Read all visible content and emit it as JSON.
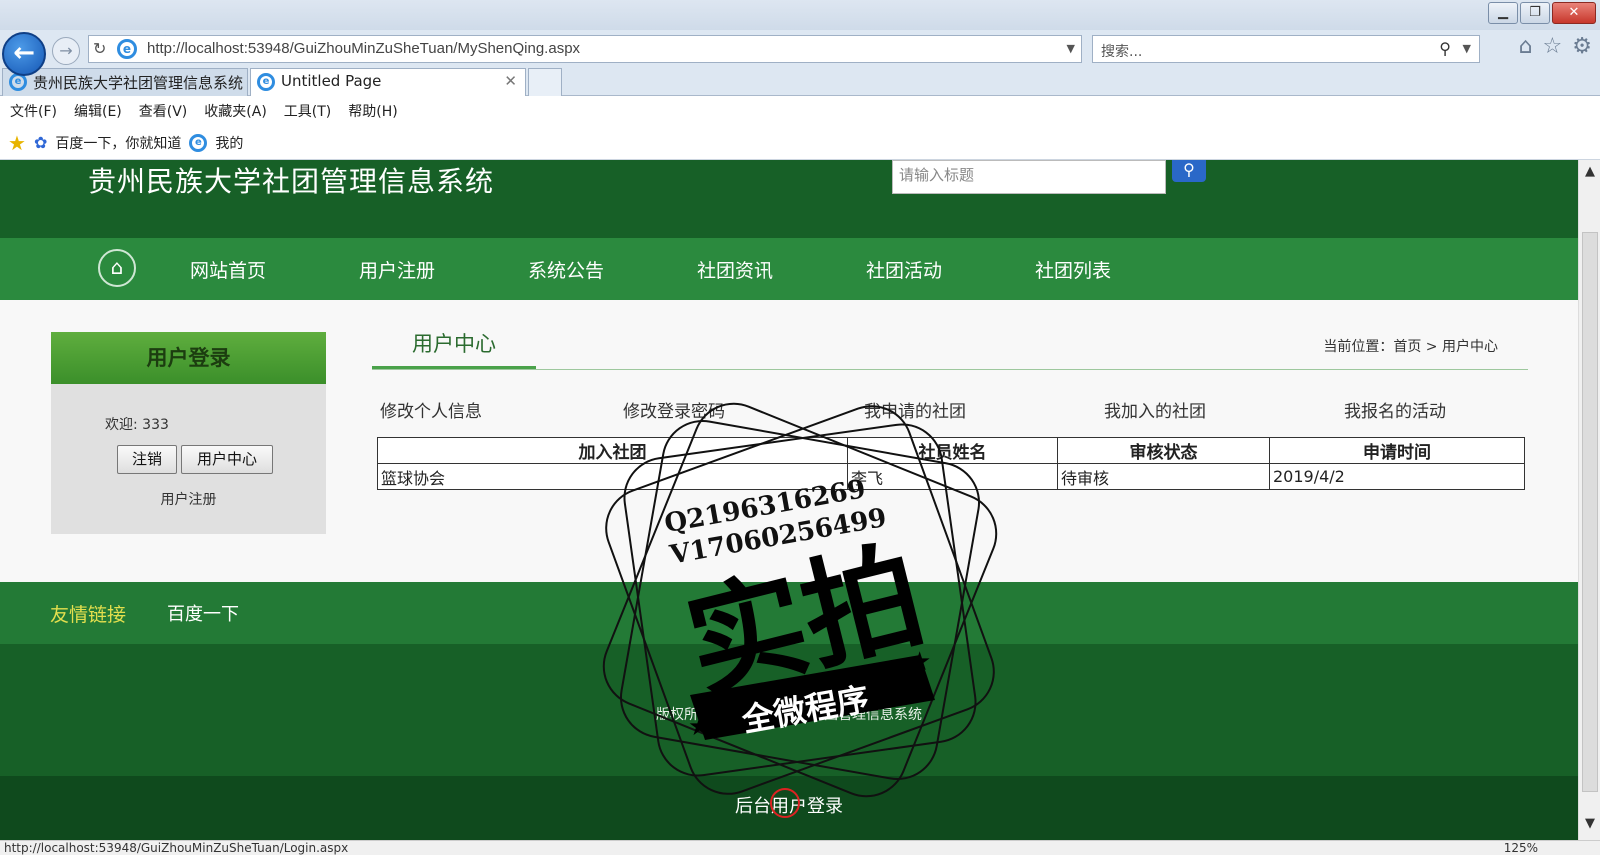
{
  "browser": {
    "url": "http://localhost:53948/GuiZhouMinZuSheTuan/MyShenQing.aspx",
    "search_placeholder": "搜索...",
    "tabs": [
      {
        "label": "贵州民族大学社团管理信息系统"
      },
      {
        "label": "Untitled Page"
      }
    ],
    "menu": [
      "文件(F)",
      "编辑(E)",
      "查看(V)",
      "收藏夹(A)",
      "工具(T)",
      "帮助(H)"
    ],
    "favorites": [
      "百度一下，你就知道",
      "我的"
    ],
    "status_url": "http://localhost:53948/GuiZhouMinZuSheTuan/Login.aspx",
    "zoom": "125%"
  },
  "site": {
    "title": "贵州民族大学社团管理信息系统",
    "search_placeholder": "请输入标题",
    "nav": [
      "网站首页",
      "用户注册",
      "系统公告",
      "社团资讯",
      "社团活动",
      "社团列表"
    ]
  },
  "login": {
    "heading": "用户登录",
    "welcome": "欢迎: 333",
    "logout_label": "注销",
    "usercenter_label": "用户中心",
    "register_label": "用户注册"
  },
  "main": {
    "tab_label": "用户中心",
    "breadcrumb": "当前位置：首页 > 用户中心",
    "sublinks": [
      "修改个人信息",
      "修改登录密码",
      "我申请的社团",
      "我加入的社团",
      "我报名的活动"
    ],
    "table": {
      "headers": [
        "加入社团",
        "社员姓名",
        "审核状态",
        "申请时间"
      ],
      "rows": [
        [
          "篮球协会",
          "李飞",
          "待审核",
          "2019/4/2"
        ]
      ]
    }
  },
  "links": {
    "label": "友情链接",
    "items": [
      "百度一下"
    ]
  },
  "footer": {
    "copyright": "版权所有：贵州民族大学社团管理信息系统",
    "admin_login": "后台用户登录"
  },
  "watermark": {
    "line1": "Q2196316269",
    "line2": "V17060256499",
    "main": "实拍",
    "banner": "全微程序"
  }
}
